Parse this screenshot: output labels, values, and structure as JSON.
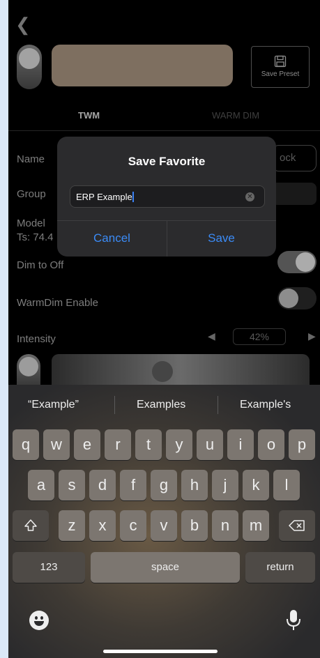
{
  "header": {
    "back_icon": "chevron-left-icon",
    "save_preset_label": "Save Preset",
    "swatch_color": "#a89480"
  },
  "tabs": [
    {
      "label": "TWM",
      "active": true
    },
    {
      "label": "WARM DIM",
      "active": false
    }
  ],
  "settings": {
    "name_label": "Name",
    "lock_label": "ock",
    "group_label": "Group",
    "model_label": "Model",
    "ts_label": "Ts: 74.4",
    "dim_to_off_label": "Dim to Off",
    "dim_to_off": true,
    "warmdim_enable_label": "WarmDim Enable",
    "warmdim_enable": false,
    "intensity_label": "Intensity",
    "intensity_value": "42%"
  },
  "dialog": {
    "title": "Save Favorite",
    "input_value": "ERP Example",
    "cancel_label": "Cancel",
    "save_label": "Save"
  },
  "keyboard": {
    "suggestions": [
      "“Example”",
      "Examples",
      "Example's"
    ],
    "row1": [
      "q",
      "w",
      "e",
      "r",
      "t",
      "y",
      "u",
      "i",
      "o",
      "p"
    ],
    "row2": [
      "a",
      "s",
      "d",
      "f",
      "g",
      "h",
      "j",
      "k",
      "l"
    ],
    "row3": [
      "z",
      "x",
      "c",
      "v",
      "b",
      "n",
      "m"
    ],
    "numbers_label": "123",
    "space_label": "space",
    "return_label": "return"
  }
}
